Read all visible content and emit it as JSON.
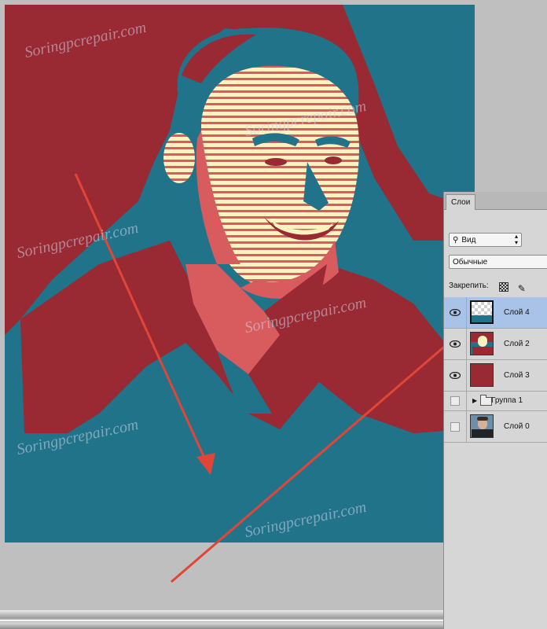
{
  "panel": {
    "tab_label": "Слои",
    "kind_filter": "Вид",
    "blend_mode": "Обычные",
    "lock_label": "Закрепить:",
    "layers": [
      {
        "name": "Слой 4",
        "visible": true,
        "selected": true,
        "thumb": "transparent-with-blue"
      },
      {
        "name": "Слой 2",
        "visible": true,
        "selected": false,
        "thumb": "portrait-popart"
      },
      {
        "name": "Слой 3",
        "visible": true,
        "selected": false,
        "thumb": "solid-red"
      },
      {
        "name": "Группа 1",
        "visible": false,
        "selected": false,
        "thumb": "folder"
      },
      {
        "name": "Слой 0",
        "visible": false,
        "selected": false,
        "thumb": "portrait-photo"
      }
    ]
  },
  "colors": {
    "canvas_teal": "#21738a",
    "canvas_red": "#992932",
    "cream": "#fcf2bd",
    "salmon": "#d85c5e",
    "arrow": "#e04638",
    "selected_row": "#a9c3e8"
  },
  "watermark_text": "Soringpcrepair.com",
  "icons": [
    "search-icon",
    "lock-pixels-icon",
    "lock-brush-icon",
    "lock-move-icon",
    "eye-icon",
    "folder-icon",
    "expand-arrow-icon"
  ]
}
